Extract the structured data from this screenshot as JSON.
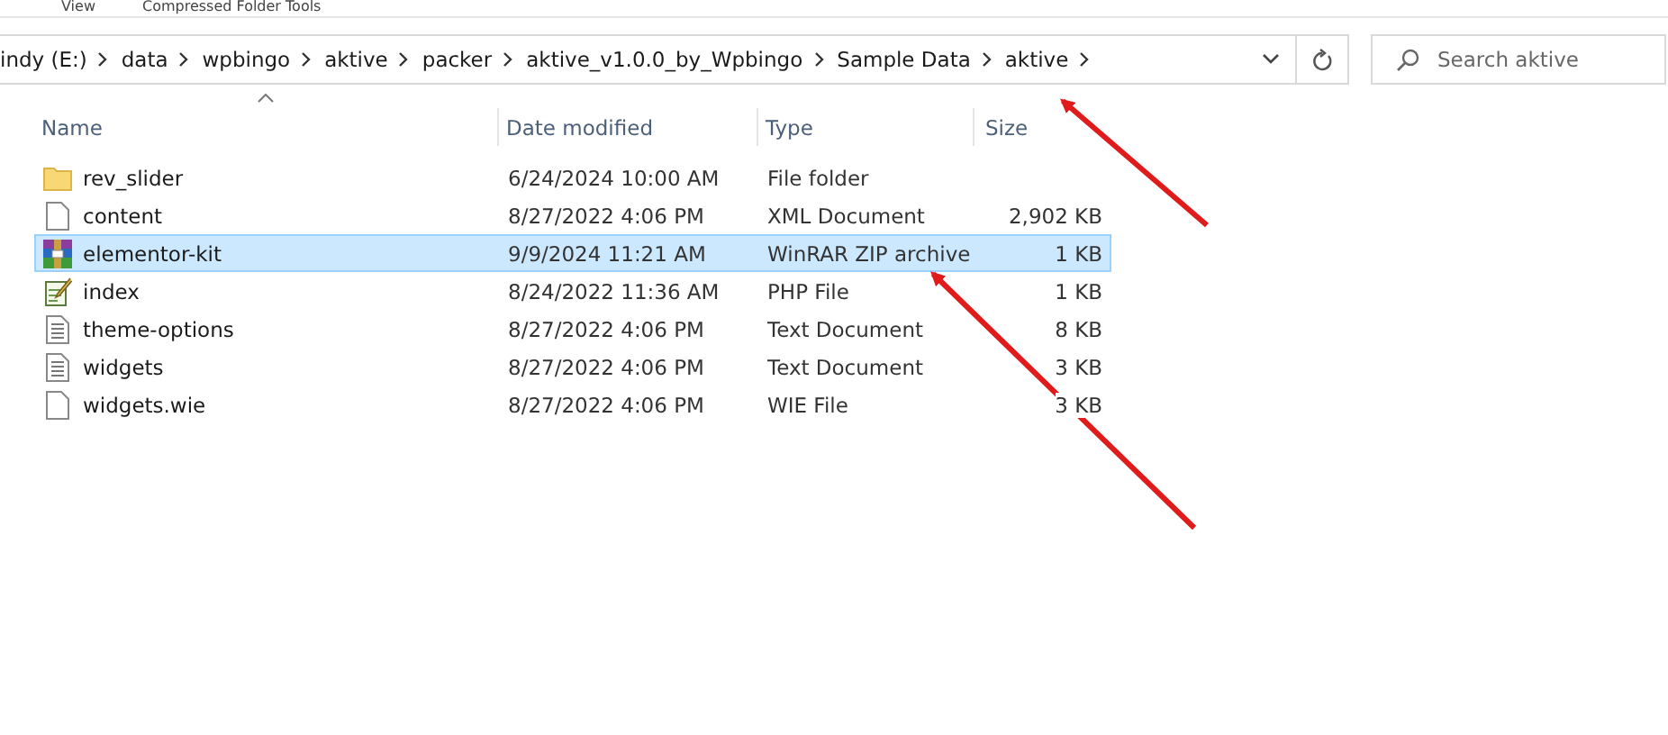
{
  "ribbon_tabs": [
    {
      "label": "View",
      "selected": false
    },
    {
      "label": "Compressed Folder Tools",
      "selected": false
    }
  ],
  "breadcrumb": [
    "indy (E:)",
    "data",
    "wpbingo",
    "aktive",
    "packer",
    "aktive_v1.0.0_by_Wpbingo",
    "Sample Data",
    "aktive"
  ],
  "search": {
    "placeholder": "Search aktive"
  },
  "columns": [
    {
      "label": "Name",
      "sorted": true
    },
    {
      "label": "Date modified",
      "sorted": false
    },
    {
      "label": "Type",
      "sorted": false
    },
    {
      "label": "Size",
      "sorted": false
    }
  ],
  "files": [
    {
      "kind": "folder",
      "name": "rev_slider",
      "date": "6/24/2024 10:00 AM",
      "type": "File folder",
      "selected": false
    },
    {
      "kind": "blank",
      "name": "content",
      "date": "8/27/2022 4:06 PM",
      "type": "XML Document",
      "size": "2,902 KB",
      "selected": false
    },
    {
      "kind": "archive",
      "name": "elementor-kit",
      "date": "9/9/2024 11:21 AM",
      "type": "WinRAR ZIP archive",
      "size": "1 KB",
      "selected": true
    },
    {
      "kind": "script",
      "name": "index",
      "date": "8/24/2022 11:36 AM",
      "type": "PHP File",
      "size": "1 KB",
      "selected": false
    },
    {
      "kind": "text",
      "name": "theme-options",
      "date": "8/27/2022 4:06 PM",
      "type": "Text Document",
      "size": "8 KB",
      "selected": false
    },
    {
      "kind": "text",
      "name": "widgets",
      "date": "8/27/2022 4:06 PM",
      "type": "Text Document",
      "size": "3 KB",
      "selected": false
    },
    {
      "kind": "blank",
      "name": "widgets.wie",
      "date": "8/27/2022 4:06 PM",
      "type": "WIE File",
      "size": "3 KB",
      "selected": false
    }
  ]
}
